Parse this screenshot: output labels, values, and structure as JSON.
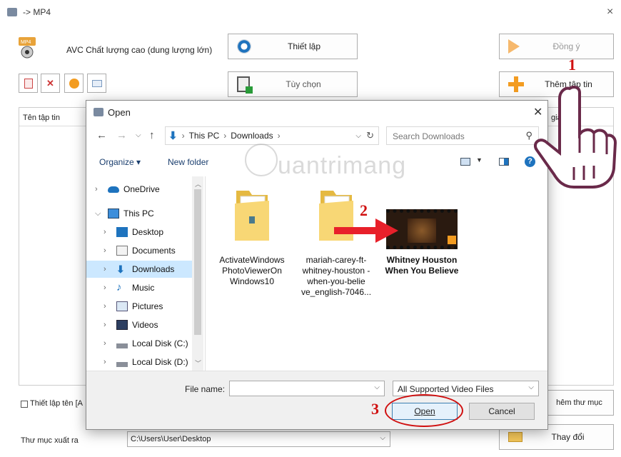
{
  "window": {
    "title": "-> MP4",
    "close_glyph": "×"
  },
  "preset": {
    "label": "AVC Chất lượng cao (dung lượng lớn)"
  },
  "buttons": {
    "settings": "Thiết lập",
    "options": "Tùy chọn",
    "ok": "Đồng ý",
    "add_file": "Thêm tập tin",
    "add_folder": "hêm thư mục",
    "change": "Thay đổi"
  },
  "file_list": {
    "col_name": "Tên tập tin",
    "col_right": "giả"
  },
  "bottom": {
    "rename_checkbox": "Thiết lập tên [A",
    "output_folder_label": "Thư mục xuất ra",
    "output_folder_value": "C:\\Users\\User\\Desktop"
  },
  "dialog": {
    "title": "Open",
    "breadcrumb": [
      "This PC",
      "Downloads"
    ],
    "search_placeholder": "Search Downloads",
    "organize": "Organize ▾",
    "new_folder": "New folder",
    "nav": [
      {
        "label": "OneDrive",
        "icon": "cloud-icon"
      },
      {
        "label": "This PC",
        "icon": "computer-icon"
      },
      {
        "label": "Desktop",
        "icon": "desktop-icon"
      },
      {
        "label": "Documents",
        "icon": "documents-icon"
      },
      {
        "label": "Downloads",
        "icon": "download-icon"
      },
      {
        "label": "Music",
        "icon": "music-icon"
      },
      {
        "label": "Pictures",
        "icon": "pictures-icon"
      },
      {
        "label": "Videos",
        "icon": "videos-icon"
      },
      {
        "label": "Local Disk (C:)",
        "icon": "drive-icon"
      },
      {
        "label": "Local Disk (D:)",
        "icon": "drive-icon"
      }
    ],
    "files": [
      {
        "name": "ActivateWindows PhotoViewerOn Windows10"
      },
      {
        "name": "mariah-carey-ft- whitney-houston -when-you-belie ve_english-7046..."
      },
      {
        "name": "Whitney Houston When You Believe"
      }
    ],
    "file_name_label": "File name:",
    "file_name_value": "",
    "filter": "All Supported Video Files",
    "open": "Open",
    "cancel": "Cancel"
  },
  "annotations": {
    "step1": "1",
    "step2": "2",
    "step3": "3"
  },
  "watermark": {
    "text": "uantrimang"
  },
  "colors": {
    "accent_orange": "#f39c21",
    "arrow_red": "#e8202a",
    "selected_nav": "#cce8ff",
    "link_blue": "#1e73be"
  }
}
